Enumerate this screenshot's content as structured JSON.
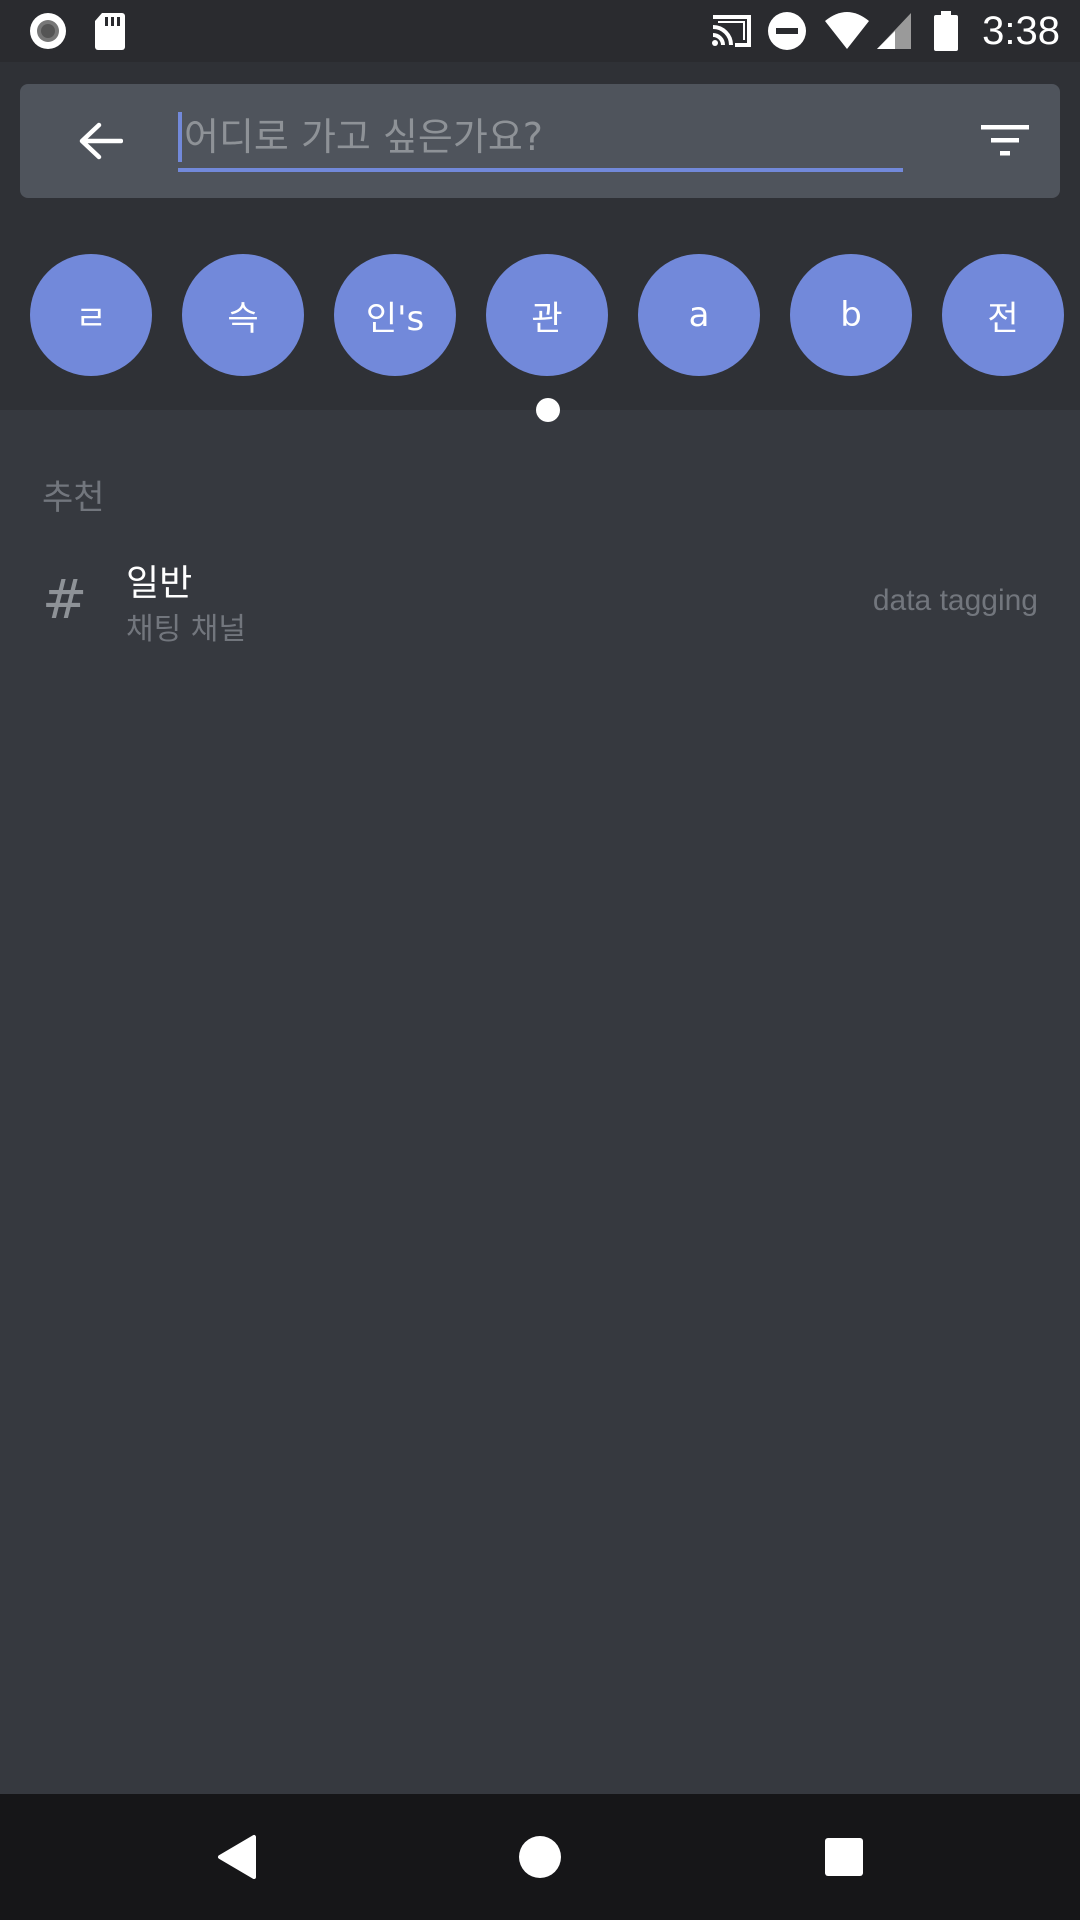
{
  "status_bar": {
    "time": "3:38",
    "icons": [
      "record-icon",
      "sd-card-icon",
      "cast-icon",
      "do-not-disturb-icon",
      "wifi-icon",
      "cell-signal-icon",
      "battery-icon"
    ]
  },
  "search": {
    "placeholder": "어디로 가고 싶은가요?",
    "value": ""
  },
  "servers": [
    "ㄹ",
    "슥",
    "인's",
    "관",
    "a",
    "b",
    "전"
  ],
  "section": {
    "title": "추천"
  },
  "channels": [
    {
      "name": "일반",
      "description": "채팅 채널",
      "server": "data tagging"
    }
  ],
  "colors": {
    "accent": "#7289da",
    "background": "#36393f",
    "header": "#2f3136",
    "search_bar": "#4f545c"
  }
}
